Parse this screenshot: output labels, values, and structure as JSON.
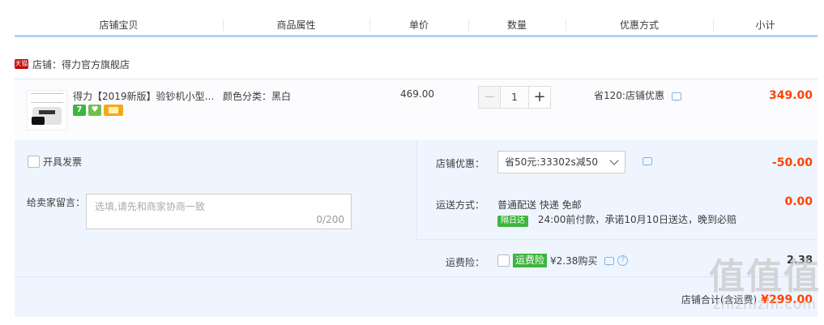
{
  "header": {
    "columns": [
      "店铺宝贝",
      "商品属性",
      "单价",
      "数量",
      "优惠方式",
      "小计"
    ]
  },
  "shop": {
    "badge": "天猫",
    "label": "店铺：得力官方旗舰店"
  },
  "item": {
    "title": "得力【2019新版】验钞机小型…",
    "badges": [
      "7",
      "♥"
    ],
    "attribute": "颜色分类：黑白",
    "unit_price": "469.00",
    "quantity": "1",
    "minus": "−",
    "plus": "+",
    "discount": "省120:店铺优惠",
    "subtotal": "349.00"
  },
  "order": {
    "invoice_label": "开具发票",
    "message_label": "给卖家留言：",
    "message_placeholder": "选填,请先和商家协商一致",
    "message_count": "0/200",
    "shop_discount_label": "店铺优惠：",
    "shop_discount_selected": "省50元:33302s减50",
    "shop_discount_amount": "-50.00",
    "shipping_label": "运送方式：",
    "shipping_method": "普通配送 快递 免邮",
    "shipping_tag": "隔日达",
    "shipping_promise": "24:00前付款，承诺10月10日送达，晚到必赔",
    "shipping_amount": "0.00",
    "insurance_label": "运费险：",
    "insurance_tag": "运费险",
    "insurance_price": "¥2.38购买",
    "insurance_amount": "2.38",
    "total_label": "店铺合计(含运费)",
    "total_value": "¥299.00"
  },
  "watermark": {
    "big": "值值值",
    "small": "zhizhizhi.com"
  },
  "colors": {
    "price_red": "#ff4400",
    "header_line": "#b2d1ff",
    "panel_bg": "#eff5ff",
    "tag_green": "#3fb43f"
  }
}
